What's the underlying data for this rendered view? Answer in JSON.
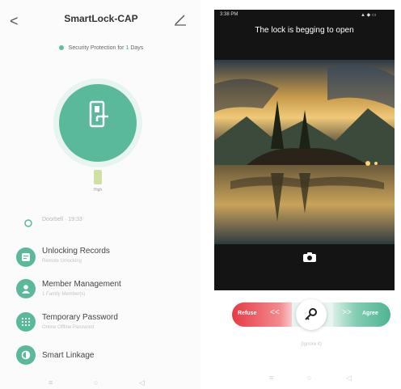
{
  "left": {
    "header": {
      "back": "<",
      "title": "SmartLock-CAP"
    },
    "security": {
      "prefix": "Security Protection for",
      "days": "1",
      "suffix": "Days"
    },
    "battery_label": "High",
    "status": {
      "text": "Doorbell · 19:33"
    },
    "menu": [
      {
        "title": "Unlocking Records",
        "subtitle": "Remote Unlocking"
      },
      {
        "title": "Member Management",
        "subtitle": "1 Family Member(s)"
      },
      {
        "title": "Temporary Password",
        "subtitle": "Online Offline Password"
      },
      {
        "title": "Smart Linkage",
        "subtitle": ""
      }
    ],
    "nav": [
      "≡",
      "○",
      "◁"
    ]
  },
  "right": {
    "status_bar": {
      "time": "3:38 PM",
      "icons": "▲ ◆ ▭"
    },
    "message": "The lock is begging to open",
    "refuse_label": "Refuse",
    "refuse_arrows": "<<",
    "agree_arrows": ">>",
    "agree_label": "Agree",
    "ignore_label": "(Ignore it)",
    "nav": [
      "≡",
      "○",
      "◁"
    ]
  },
  "colors": {
    "accent": "#5ab89b",
    "refuse": "#e83a45"
  }
}
